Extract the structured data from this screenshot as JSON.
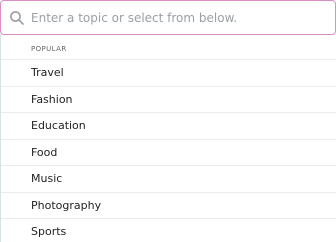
{
  "search": {
    "placeholder": "Enter a topic or select from below.",
    "icon": "search-icon"
  },
  "colors": {
    "search_border": "#d98fc6",
    "divider": "#e7ecef",
    "left_rule": "#d6e1e6"
  },
  "list": {
    "section_label": "POPULAR",
    "items": [
      {
        "label": "Travel"
      },
      {
        "label": "Fashion"
      },
      {
        "label": "Education"
      },
      {
        "label": "Food"
      },
      {
        "label": "Music"
      },
      {
        "label": "Photography"
      },
      {
        "label": "Sports"
      }
    ]
  }
}
